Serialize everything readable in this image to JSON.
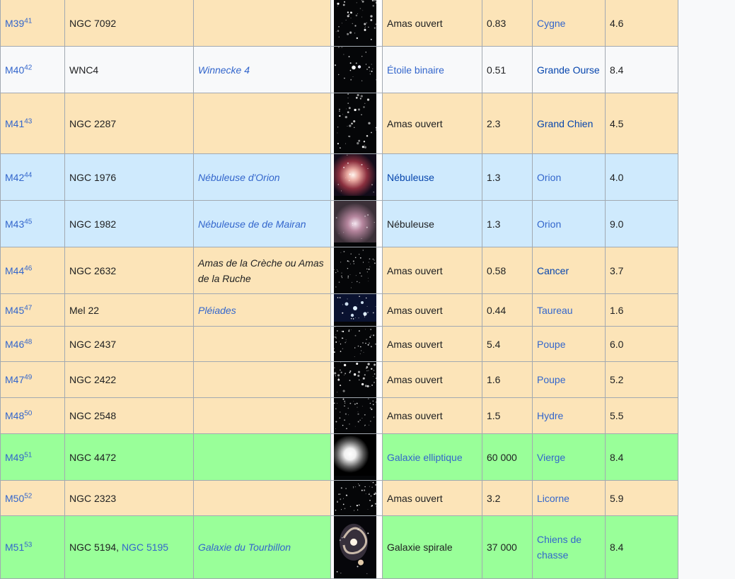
{
  "rows": [
    {
      "m": "M39",
      "ref": "41",
      "ngc": "NGC 7092",
      "ngc_link": "",
      "name": "",
      "type": "Amas ouvert",
      "dist": "0.83",
      "const": "Cygne",
      "mag": "4.6",
      "cat": "cluster",
      "thumb": "open-cluster"
    },
    {
      "m": "M40",
      "ref": "42",
      "ngc": "WNC4",
      "ngc_link": "",
      "name": "Winnecke 4",
      "type": "Étoile binaire",
      "dist": "0.51",
      "const": "Grande Ourse",
      "mag": "8.4",
      "cat": "star",
      "thumb": "binary-star"
    },
    {
      "m": "M41",
      "ref": "43",
      "ngc": "NGC 2287",
      "ngc_link": "",
      "name": "",
      "type": "Amas ouvert",
      "dist": "2.3",
      "const": "Grand Chien",
      "mag": "4.5",
      "cat": "cluster",
      "thumb": "open-cluster"
    },
    {
      "m": "M42",
      "ref": "44",
      "ngc": "NGC 1976",
      "ngc_link": "",
      "name": "Nébuleuse d'Orion",
      "type": "Nébuleuse",
      "dist": "1.3",
      "const": "Orion",
      "mag": "4.0",
      "cat": "nebula",
      "thumb": "orion-nebula"
    },
    {
      "m": "M43",
      "ref": "45",
      "ngc": "NGC 1982",
      "ngc_link": "",
      "name": "Nébuleuse de de Mairan",
      "type": "Nébuleuse",
      "dist": "1.3",
      "const": "Orion",
      "mag": "9.0",
      "cat": "nebula",
      "thumb": "mairan-nebula"
    },
    {
      "m": "M44",
      "ref": "46",
      "ngc": "NGC 2632",
      "ngc_link": "",
      "name": "Amas de la Crèche ou Amas de la Ruche",
      "type": "Amas ouvert",
      "dist": "0.58",
      "const": "Cancer",
      "mag": "3.7",
      "cat": "cluster",
      "thumb": "open-cluster"
    },
    {
      "m": "M45",
      "ref": "47",
      "ngc": "Mel 22",
      "ngc_link": "",
      "name": "Pléiades",
      "type": "Amas ouvert",
      "dist": "0.44",
      "const": "Taureau",
      "mag": "1.6",
      "cat": "cluster",
      "thumb": "pleiades"
    },
    {
      "m": "M46",
      "ref": "48",
      "ngc": "NGC 2437",
      "ngc_link": "",
      "name": "",
      "type": "Amas ouvert",
      "dist": "5.4",
      "const": "Poupe",
      "mag": "6.0",
      "cat": "cluster",
      "thumb": "open-cluster"
    },
    {
      "m": "M47",
      "ref": "49",
      "ngc": "NGC 2422",
      "ngc_link": "",
      "name": "",
      "type": "Amas ouvert",
      "dist": "1.6",
      "const": "Poupe",
      "mag": "5.2",
      "cat": "cluster",
      "thumb": "open-cluster"
    },
    {
      "m": "M48",
      "ref": "50",
      "ngc": "NGC 2548",
      "ngc_link": "",
      "name": "",
      "type": "Amas ouvert",
      "dist": "1.5",
      "const": "Hydre",
      "mag": "5.5",
      "cat": "cluster",
      "thumb": "open-cluster"
    },
    {
      "m": "M49",
      "ref": "51",
      "ngc": "NGC 4472",
      "ngc_link": "",
      "name": "",
      "type": "Galaxie elliptique",
      "dist": "60 000",
      "const": "Vierge",
      "mag": "8.4",
      "cat": "galaxy",
      "thumb": "elliptical-galaxy"
    },
    {
      "m": "M50",
      "ref": "52",
      "ngc": "NGC 2323",
      "ngc_link": "",
      "name": "",
      "type": "Amas ouvert",
      "dist": "3.2",
      "const": "Licorne",
      "mag": "5.9",
      "cat": "cluster",
      "thumb": "open-cluster"
    },
    {
      "m": "M51",
      "ref": "53",
      "ngc": "NGC 5194,",
      "ngc_link": "NGC 5195",
      "name": "Galaxie du Tourbillon",
      "type": "Galaxie spirale",
      "dist": "37 000",
      "const": "Chiens de chasse",
      "mag": "8.4",
      "cat": "galaxy",
      "thumb": "spiral-galaxy"
    }
  ],
  "link_types": [
    "Étoile binaire",
    "Galaxie elliptique"
  ],
  "dark_types": [
    "Nébuleuse"
  ],
  "dark_consts": [
    "Grande Ourse",
    "Grand Chien",
    "Cancer"
  ],
  "colors": {
    "cluster": "#fce4b8",
    "star": "#f8f9fa",
    "nebula": "#cfeafd",
    "galaxy": "#99ff99",
    "link": "#3366cc"
  }
}
